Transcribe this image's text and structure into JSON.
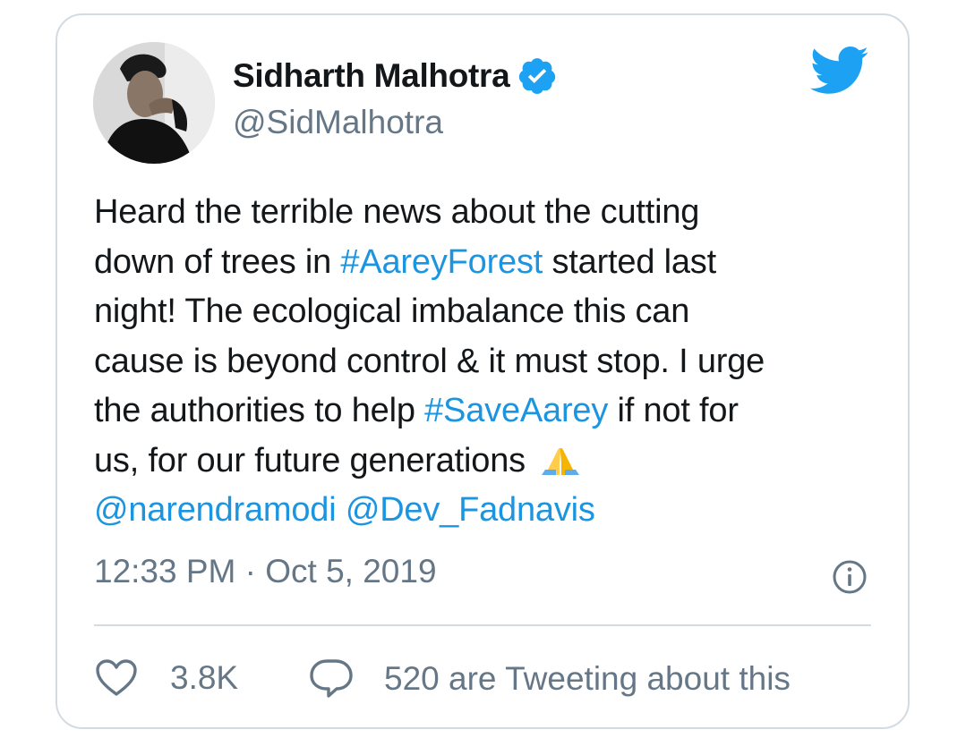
{
  "author": {
    "name": "Sidharth Malhotra",
    "handle": "@SidMalhotra",
    "verified": true
  },
  "tweet": {
    "lines": [
      [
        {
          "t": "Heard the terrible news about the cutting",
          "k": "text"
        }
      ],
      [
        {
          "t": "down of trees in ",
          "k": "text"
        },
        {
          "t": "#AareyForest",
          "k": "link"
        },
        {
          "t": " started last",
          "k": "text"
        }
      ],
      [
        {
          "t": "night! The ecological imbalance this can",
          "k": "text"
        }
      ],
      [
        {
          "t": "cause is beyond control & it must stop. I urge",
          "k": "text"
        }
      ],
      [
        {
          "t": "the authorities to help ",
          "k": "text"
        },
        {
          "t": "#SaveAarey",
          "k": "link"
        },
        {
          "t": " if not for",
          "k": "text"
        }
      ],
      [
        {
          "t": "us, for our future generations ",
          "k": "text"
        },
        {
          "t": "folded-hands-emoji",
          "k": "emoji"
        }
      ],
      [
        {
          "t": "@narendramodi",
          "k": "link"
        },
        {
          "t": " ",
          "k": "text"
        },
        {
          "t": "@Dev_Fadnavis",
          "k": "link"
        }
      ]
    ]
  },
  "timestamp": "12:33 PM · Oct 5, 2019",
  "actions": {
    "likes": "3.8K",
    "replies_label": "520 are Tweeting about this"
  },
  "icons": {
    "brand": "twitter-bird-icon",
    "verified": "verified-badge-icon",
    "info": "info-icon",
    "like": "heart-icon",
    "reply": "speech-bubble-icon"
  },
  "colors": {
    "link": "#1b95e0",
    "brand": "#1da1f2",
    "text": "#14171a",
    "muted": "#657786",
    "border": "#d3dbe2"
  }
}
